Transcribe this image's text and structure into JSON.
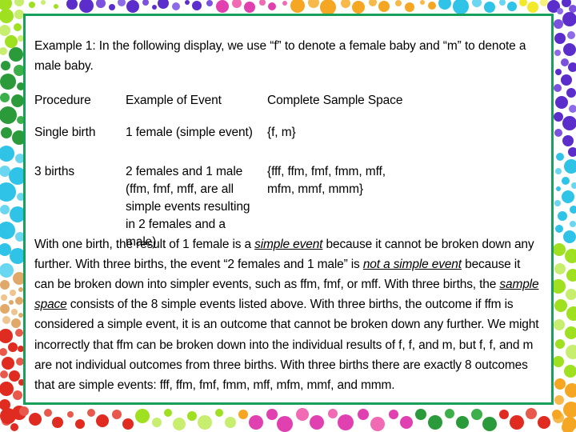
{
  "slide": {
    "intro": "Example 1: In the following display, we use “f” to denote a female baby and “m” to denote a male baby.",
    "table": {
      "headers": {
        "procedure": "Procedure",
        "example_of_event": "Example of Event",
        "complete_sample_space": "Complete Sample Space"
      },
      "rows": [
        {
          "procedure": "Single birth",
          "example_of_event": "1 female (simple event)",
          "complete_sample_space": "{f, m}"
        },
        {
          "procedure": "3 births",
          "example_of_event": "2 females and 1 male (ffm, fmf, mff, are all simple events resulting in 2 females and a male)",
          "complete_sample_space": "{fff, ffm, fmf, fmm, mff, mfm, mmf, mmm}"
        }
      ]
    },
    "paragraph": {
      "seg1": "With one birth, the result of 1 female is a ",
      "em1": "simple event",
      "seg2": " because it cannot be broken down any further.  With three births, the event “2 females and 1 male” is ",
      "em2": "not a simple event",
      "seg3": " because it can be broken down into simpler events, such as ffm, fmf, or mff.  With three births, the ",
      "em3": "sample space",
      "seg4": " consists of the 8 simple events listed above.  With three births, the outcome if ffm is considered a simple event, it is an outcome that cannot be broken down any further.  We might incorrectly that ffm can be broken down into the individual results of f, f, and m, but f, f, and m are not individual outcomes from three births.  With three births there are exactly 8 outcomes that are simple events: fff, ffm, fmf, fmm, mff, mfm, mmf, and mmm."
    }
  },
  "decor": {
    "card_border_color": "#17a05a",
    "dot_palette": {
      "purple": "#5b2ecc",
      "magenta": "#e040b0",
      "pink": "#f06ab4",
      "orange": "#f5a623",
      "cyan": "#2fc3e8",
      "yellow": "#f2e92a",
      "lime": "#9fe020",
      "green": "#2a9a3a",
      "red": "#e02b20",
      "tan": "#e0a96a"
    }
  }
}
